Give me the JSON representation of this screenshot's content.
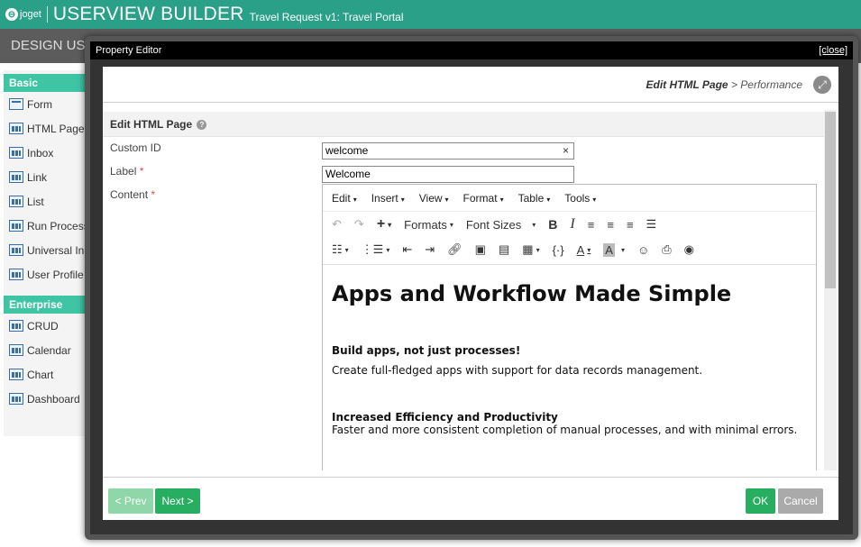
{
  "app": {
    "logo_text": "joget",
    "title": "USERVIEW BUILDER",
    "subtitle": "Travel Request v1: Travel Portal"
  },
  "sub_bar": {
    "text": "DESIGN US"
  },
  "palette": {
    "basic_header": "Basic",
    "basic_items": [
      "Form",
      "HTML Page",
      "Inbox",
      "Link",
      "List",
      "Run Process",
      "Universal Inb",
      "User Profile"
    ],
    "enterprise_header": "Enterprise",
    "enterprise_items": [
      "CRUD",
      "Calendar",
      "Chart",
      "Dashboard"
    ]
  },
  "dialog": {
    "title": "Property Editor",
    "close_label": "[close]",
    "breadcrumb": {
      "current": "Edit HTML Page",
      "separator": " > ",
      "next": "Performance"
    },
    "section_title": "Edit HTML Page",
    "fields": {
      "custom_id": {
        "label": "Custom ID",
        "value": "welcome"
      },
      "label": {
        "label": "Label",
        "value": "Welcome",
        "required": "*"
      },
      "content": {
        "label": "Content",
        "required": "*"
      }
    },
    "editor": {
      "menus": [
        "Edit",
        "Insert",
        "View",
        "Format",
        "Table",
        "Tools"
      ],
      "toolbar": {
        "formats": "Formats",
        "font_sizes": "Font Sizes"
      },
      "content": {
        "heading": "Apps and Workflow Made Simple",
        "sub1": "Build apps, not just processes!",
        "para1": "Create full-fledged apps with support for data records management.",
        "sub2": "Increased Efficiency and Productivity",
        "para2": "Faster and more consistent completion of manual processes, and with minimal errors."
      }
    },
    "footer": {
      "prev": "< Prev",
      "next": "Next >",
      "ok": "OK",
      "cancel": "Cancel"
    }
  },
  "colors": {
    "header_green": "#2aa089",
    "palette_header": "#3fc4a4",
    "button_green": "#27ae60"
  }
}
